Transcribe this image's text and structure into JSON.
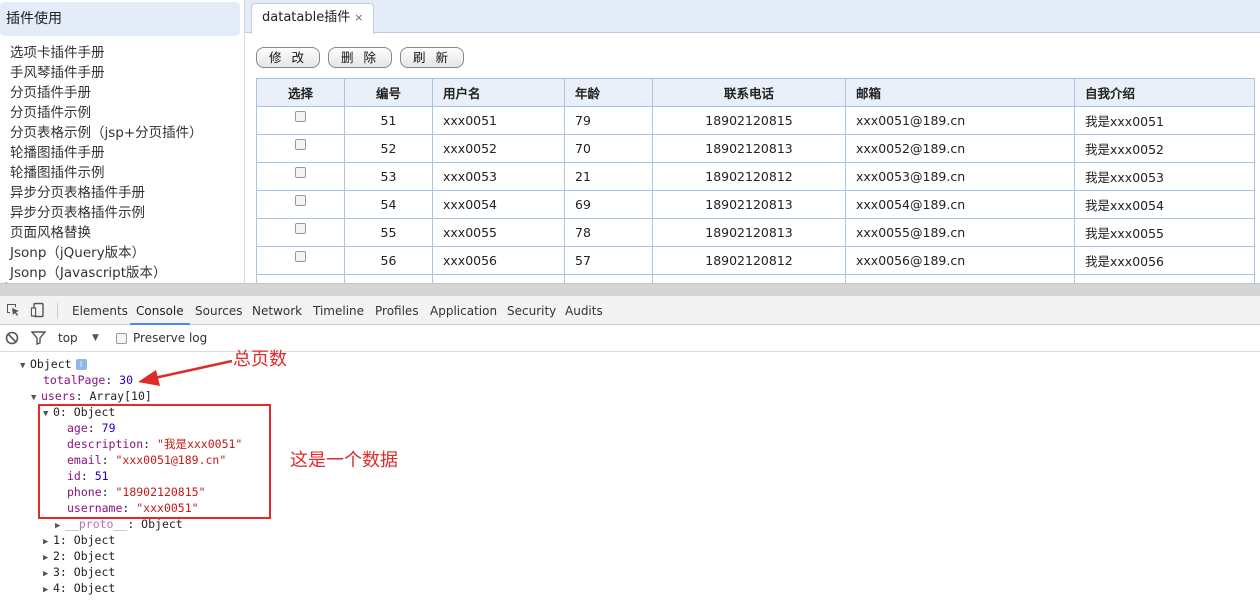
{
  "sidebar": {
    "title": "插件使用",
    "items": [
      "选项卡插件手册",
      "手风琴插件手册",
      "分页插件手册",
      "分页插件示例",
      "分页表格示例（jsp+分页插件）",
      "轮播图插件手册",
      "轮播图插件示例",
      "异步分页表格插件手册",
      "异步分页表格插件示例",
      "页面风格替换",
      "Jsonp（jQuery版本）",
      "Jsonp（Javascript版本）"
    ]
  },
  "tab": {
    "label": "datatable插件",
    "close": "×"
  },
  "toolbar": {
    "edit": "修 改",
    "delete": "删 除",
    "refresh": "刷 新"
  },
  "table": {
    "headers": [
      "选择",
      "编号",
      "用户名",
      "年龄",
      "联系电话",
      "邮箱",
      "自我介绍"
    ],
    "rows": [
      [
        "51",
        "xxx0051",
        "79",
        "18902120815",
        "xxx0051@189.cn",
        "我是xxx0051"
      ],
      [
        "52",
        "xxx0052",
        "70",
        "18902120813",
        "xxx0052@189.cn",
        "我是xxx0052"
      ],
      [
        "53",
        "xxx0053",
        "21",
        "18902120812",
        "xxx0053@189.cn",
        "我是xxx0053"
      ],
      [
        "54",
        "xxx0054",
        "69",
        "18902120813",
        "xxx0054@189.cn",
        "我是xxx0054"
      ],
      [
        "55",
        "xxx0055",
        "78",
        "18902120813",
        "xxx0055@189.cn",
        "我是xxx0055"
      ],
      [
        "56",
        "xxx0056",
        "57",
        "18902120812",
        "xxx0056@189.cn",
        "我是xxx0056"
      ]
    ]
  },
  "devtools": {
    "tabs": [
      "Elements",
      "Console",
      "Sources",
      "Network",
      "Timeline",
      "Profiles",
      "Application",
      "Security",
      "Audits"
    ],
    "active_tab": "Console",
    "context": "top",
    "preserve_log": "Preserve log"
  },
  "console": {
    "root": "Object",
    "totalPage_key": "totalPage",
    "totalPage_value": "30",
    "users_key": "users",
    "users_type": "Array[10]",
    "item0_label": "0: Object",
    "fields": [
      {
        "key": "age",
        "value": "79",
        "kind": "number"
      },
      {
        "key": "description",
        "value": "\"我是xxx0051\"",
        "kind": "string"
      },
      {
        "key": "email",
        "value": "\"xxx0051@189.cn\"",
        "kind": "string"
      },
      {
        "key": "id",
        "value": "51",
        "kind": "number"
      },
      {
        "key": "phone",
        "value": "\"18902120815\"",
        "kind": "string"
      },
      {
        "key": "username",
        "value": "\"xxx0051\"",
        "kind": "string"
      }
    ],
    "proto": "__proto__",
    "proto_value": "Object",
    "more_items": [
      "1: Object",
      "2: Object",
      "3: Object",
      "4: Object"
    ]
  },
  "annotations": {
    "total_pages": "总页数",
    "one_record": "这是一个数据",
    "color": "#e02b2b"
  }
}
